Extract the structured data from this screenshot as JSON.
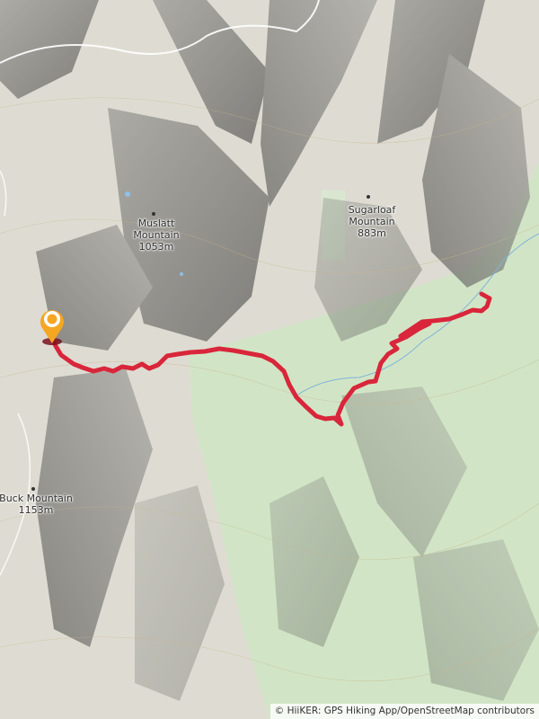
{
  "map": {
    "trail_color": "#d9263b",
    "start_marker_color": "#f5a623",
    "forest_color": "#cfe6c4",
    "terrain_base_color": "#dedcd2"
  },
  "peaks": [
    {
      "name_line1": "Muslatt",
      "name_line2": "Mountain",
      "elevation": "1053m"
    },
    {
      "name_line1": "Sugarloaf",
      "name_line2": "Mountain",
      "elevation": "883m"
    },
    {
      "name_line1": "Buck Mountain",
      "name_line2": "",
      "elevation": "1153m"
    }
  ],
  "attribution": "© HiiKER: GPS Hiking App/OpenStreetMap contributors"
}
